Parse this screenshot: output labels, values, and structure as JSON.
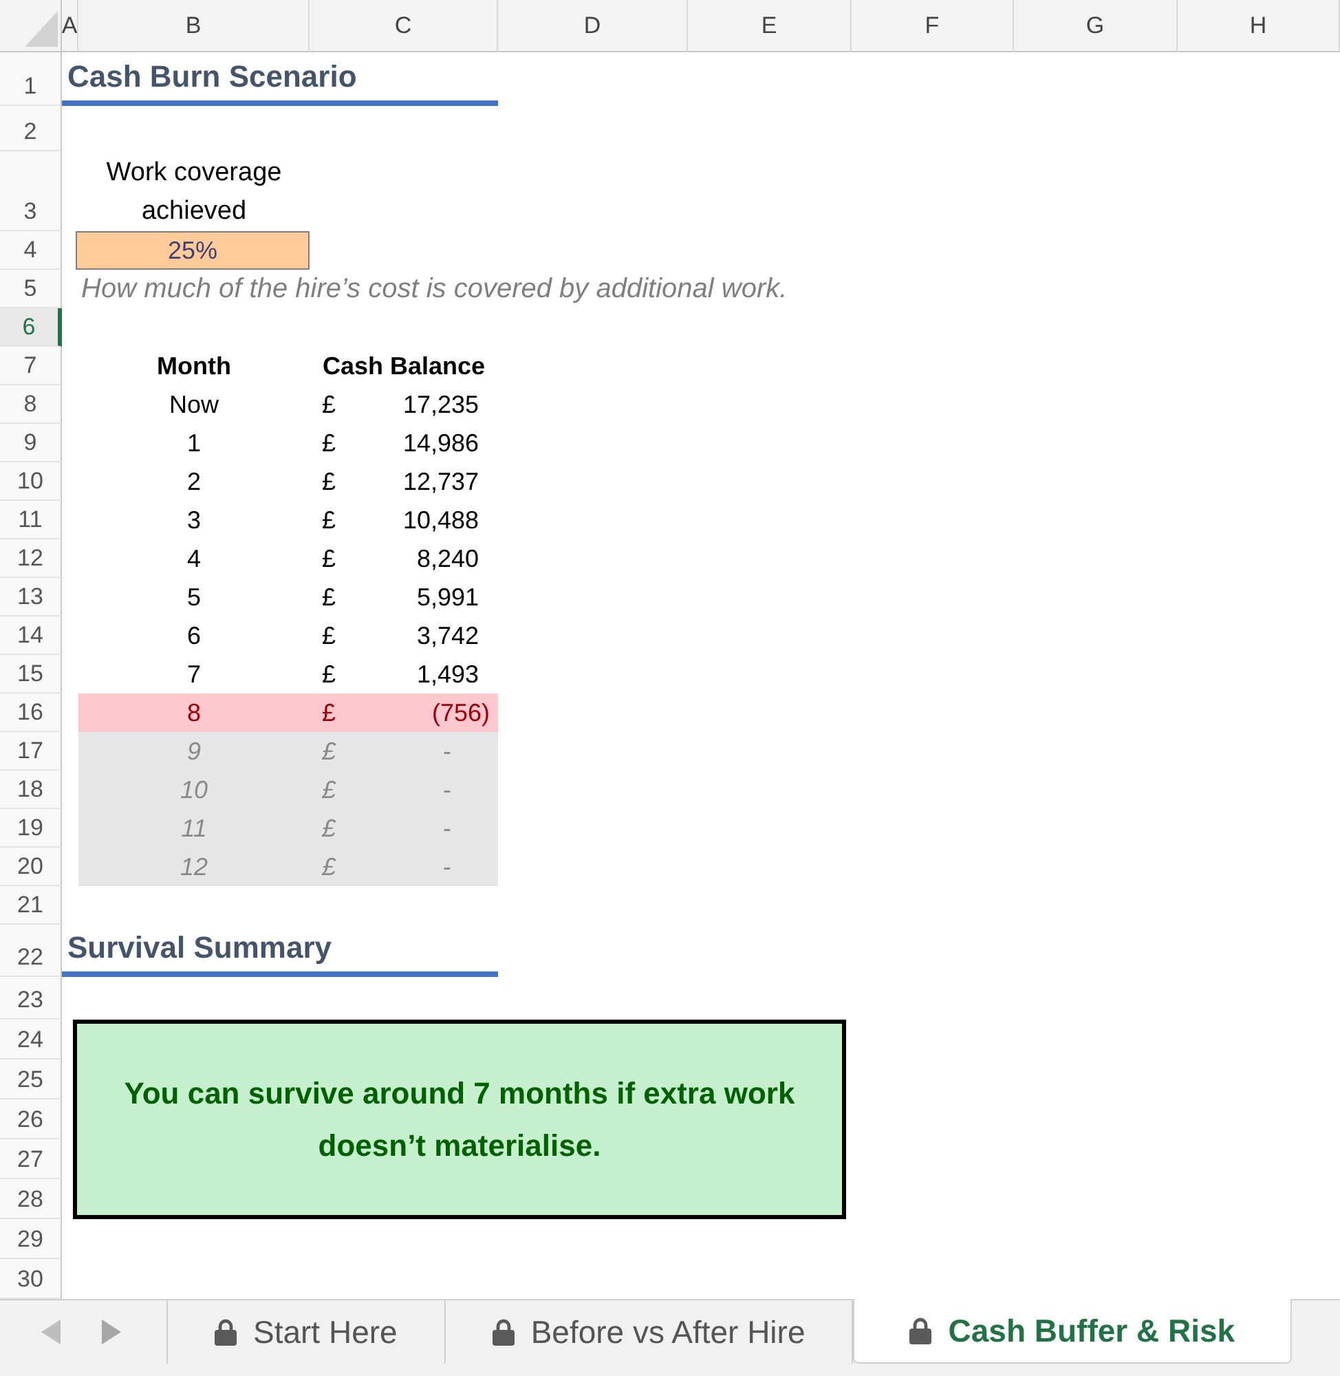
{
  "column_headers": [
    "A",
    "B",
    "C",
    "D",
    "E",
    "F",
    "G",
    "H"
  ],
  "row_headers": [
    {
      "label": "1",
      "selected": false
    },
    {
      "label": "2",
      "selected": false
    },
    {
      "label": "3",
      "selected": false
    },
    {
      "label": "4",
      "selected": false
    },
    {
      "label": "5",
      "selected": false
    },
    {
      "label": "6",
      "selected": true
    },
    {
      "label": "7",
      "selected": false
    },
    {
      "label": "8",
      "selected": false
    },
    {
      "label": "9",
      "selected": false
    },
    {
      "label": "10",
      "selected": false
    },
    {
      "label": "11",
      "selected": false
    },
    {
      "label": "12",
      "selected": false
    },
    {
      "label": "13",
      "selected": false
    },
    {
      "label": "14",
      "selected": false
    },
    {
      "label": "15",
      "selected": false
    },
    {
      "label": "16",
      "selected": false
    },
    {
      "label": "17",
      "selected": false
    },
    {
      "label": "18",
      "selected": false
    },
    {
      "label": "19",
      "selected": false
    },
    {
      "label": "20",
      "selected": false
    },
    {
      "label": "21",
      "selected": false
    },
    {
      "label": "22",
      "selected": false
    },
    {
      "label": "23",
      "selected": false
    },
    {
      "label": "24",
      "selected": false
    },
    {
      "label": "25",
      "selected": false
    },
    {
      "label": "26",
      "selected": false
    },
    {
      "label": "27",
      "selected": false
    },
    {
      "label": "28",
      "selected": false
    },
    {
      "label": "29",
      "selected": false
    },
    {
      "label": "30",
      "selected": false
    }
  ],
  "scenario": {
    "title": "Cash Burn Scenario",
    "input_label": "Work coverage achieved",
    "input_value": "25%",
    "note": "How much of the hire’s cost is covered by additional work."
  },
  "table": {
    "columns": [
      "Month",
      "Cash Balance"
    ],
    "rows": [
      {
        "kind": "normal",
        "month": "Now",
        "currency": "£",
        "balance": "17,235"
      },
      {
        "kind": "normal",
        "month": "1",
        "currency": "£",
        "balance": "14,986"
      },
      {
        "kind": "normal",
        "month": "2",
        "currency": "£",
        "balance": "12,737"
      },
      {
        "kind": "normal",
        "month": "3",
        "currency": "£",
        "balance": "10,488"
      },
      {
        "kind": "normal",
        "month": "4",
        "currency": "£",
        "balance": "8,240"
      },
      {
        "kind": "normal",
        "month": "5",
        "currency": "£",
        "balance": "5,991"
      },
      {
        "kind": "normal",
        "month": "6",
        "currency": "£",
        "balance": "3,742"
      },
      {
        "kind": "normal",
        "month": "7",
        "currency": "£",
        "balance": "1,493"
      },
      {
        "kind": "negative",
        "month": "8",
        "currency": "£",
        "balance": "(756)"
      },
      {
        "kind": "inactive",
        "month": "9",
        "currency": "£",
        "balance": "-"
      },
      {
        "kind": "inactive",
        "month": "10",
        "currency": "£",
        "balance": "-"
      },
      {
        "kind": "inactive",
        "month": "11",
        "currency": "£",
        "balance": "-"
      },
      {
        "kind": "inactive",
        "month": "12",
        "currency": "£",
        "balance": "-"
      }
    ]
  },
  "summary": {
    "title": "Survival Summary",
    "message": "You can survive around 7 months if extra work doesn’t materialise."
  },
  "sheet_tabs": [
    {
      "label": "Start Here",
      "selected": false,
      "locked": true
    },
    {
      "label": "Before vs After Hire",
      "selected": false,
      "locked": true
    },
    {
      "label": "Cash Buffer & Risk",
      "selected": true,
      "locked": true
    }
  ]
}
